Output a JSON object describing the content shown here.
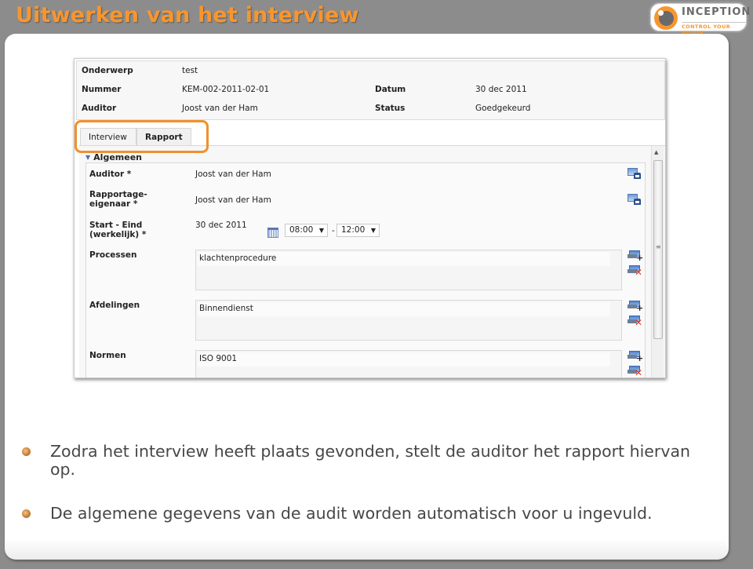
{
  "slide": {
    "title": "Uitwerken van het interview",
    "logo": {
      "brand": "INCEPTION",
      "tagline": "CONTROL YOUR VISION",
      "icon": "eye-logo-icon"
    },
    "accent_color": "#f7962f"
  },
  "app": {
    "header": {
      "onderwerp_label": "Onderwerp",
      "onderwerp_value": "test",
      "nummer_label": "Nummer",
      "nummer_value": "KEM-002-2011-02-01",
      "auditor_label": "Auditor",
      "auditor_value": "Joost van der Ham",
      "datum_label": "Datum",
      "datum_value": "30 dec 2011",
      "status_label": "Status",
      "status_value": "Goedgekeurd"
    },
    "tabs": [
      {
        "label": "Interview",
        "active": false
      },
      {
        "label": "Rapport",
        "active": true
      }
    ],
    "section": {
      "title": "Algemeen",
      "collapse_icon": "triangle-down-icon",
      "fields": {
        "auditor_label": "Auditor *",
        "auditor_value": "Joost van der Ham",
        "eigenaar_label_1": "Rapportage-",
        "eigenaar_label_2": "eigenaar *",
        "eigenaar_value": "Joost van der Ham",
        "startend_label_1": "Start - Eind",
        "startend_label_2": "(werkelijk) *",
        "startend_date": "30 dec 2011",
        "start_time": "08:00",
        "end_time": "12:00",
        "time_separator": "-",
        "processen_label": "Processen",
        "processen_items": [
          "klachtenprocedure"
        ],
        "afdelingen_label": "Afdelingen",
        "afdelingen_items": [
          "Binnendienst"
        ],
        "normen_label": "Normen",
        "normen_items": [
          "ISO 9001"
        ]
      }
    },
    "dropdown_arrow": "▼",
    "scroll_up": "▲",
    "scroll_grip": "≡"
  },
  "bullets": [
    "Zodra het interview heeft plaats gevonden, stelt de auditor het rapport hiervan op.",
    "De algemene gegevens van de audit worden automatisch voor u ingevuld."
  ]
}
